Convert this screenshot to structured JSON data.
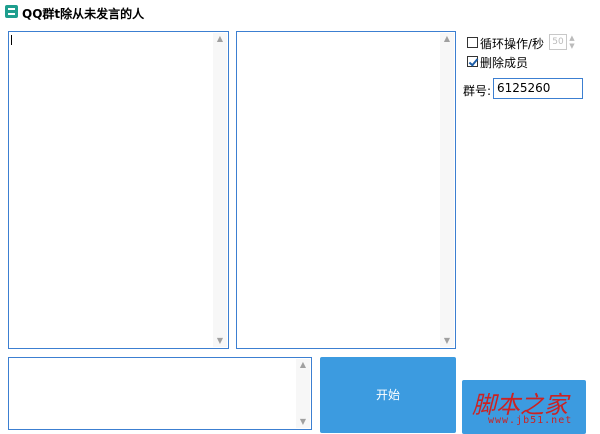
{
  "window": {
    "title": "QQ群t除从未发言的人",
    "icon": "app-icon"
  },
  "options": {
    "loop_label": "循环操作/秒",
    "loop_checked": false,
    "loop_interval": "50",
    "delete_label": "删除成员",
    "delete_checked": true,
    "group_label": "群号:",
    "group_value": "6125260"
  },
  "buttons": {
    "start_label": "开始"
  },
  "watermark": {
    "text": "脚本之家",
    "url": "www.jb51.net"
  },
  "colors": {
    "accent": "#3c9be0",
    "border": "#3c7fd1",
    "watermark": "#cc2222"
  }
}
